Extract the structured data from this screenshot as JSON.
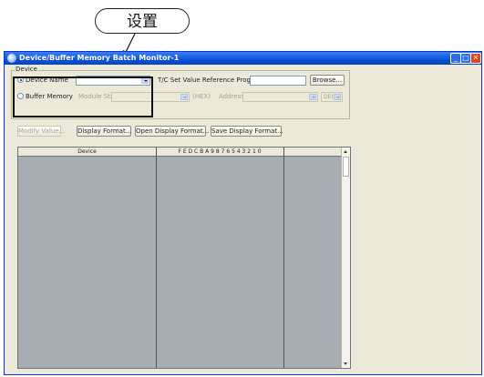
{
  "annotation": {
    "callout_text": "设置"
  },
  "window": {
    "title": "Device/Buffer Memory Batch Monitor-1",
    "controls": {
      "minimize": "_",
      "maximize": "□",
      "close": "✕"
    }
  },
  "device_group": {
    "label": "Device",
    "device_name_label": "Device Name",
    "device_name_value": "",
    "buffer_memory_label": "Buffer Memory",
    "module_start_label": "Module Start",
    "module_start_unit": "(HEX)",
    "address_label": "Address",
    "address_format": "DEC",
    "tc_label": "T/C Set Value Reference Program",
    "tc_value": "",
    "browse_button": "Browse..."
  },
  "toolbar": {
    "modify_value": "Modify Value...",
    "display_format": "Display Format...",
    "open_display_format": "Open Display Format...",
    "save_display_format": "Save Display Format..."
  },
  "grid": {
    "column_device": "Device",
    "column_bits": "F E D C B A 9 8 7 6 5 4 3 2 1 0",
    "column_value": ""
  }
}
